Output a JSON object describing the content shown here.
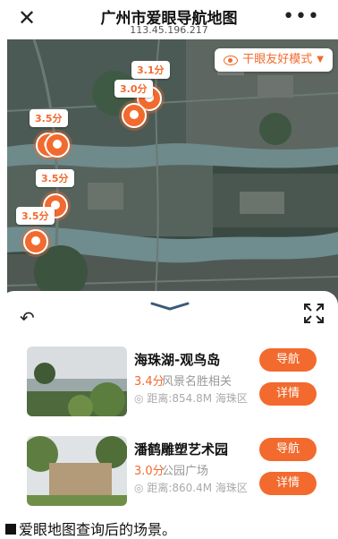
{
  "header": {
    "close_icon": "close-icon",
    "title": "广州市爱眼导航地图",
    "subtitle": "113.45.196.217",
    "more_icon": "more-icon"
  },
  "map": {
    "mode_label": "干眼友好模式",
    "markers": [
      {
        "rating": "3.1分"
      },
      {
        "rating": "3.0分"
      },
      {
        "rating": "3.5分"
      },
      {
        "rating": "3.5分"
      },
      {
        "rating": "3.5分"
      }
    ]
  },
  "sheet": {
    "results": [
      {
        "name": "海珠湖-观鸟岛",
        "rating": "3.4分",
        "category": "风景名胜相关",
        "distance": "距离:854.8M  海珠区",
        "nav_label": "导航",
        "detail_label": "详情"
      },
      {
        "name": "潘鹤雕塑艺术园",
        "rating": "3.0分",
        "category": "公园广场",
        "distance": "距离:860.4M  海珠区",
        "nav_label": "导航",
        "detail_label": "详情"
      }
    ]
  },
  "caption": "爱眼地图查询后的场景。",
  "colors": {
    "accent": "#f26a2e"
  }
}
